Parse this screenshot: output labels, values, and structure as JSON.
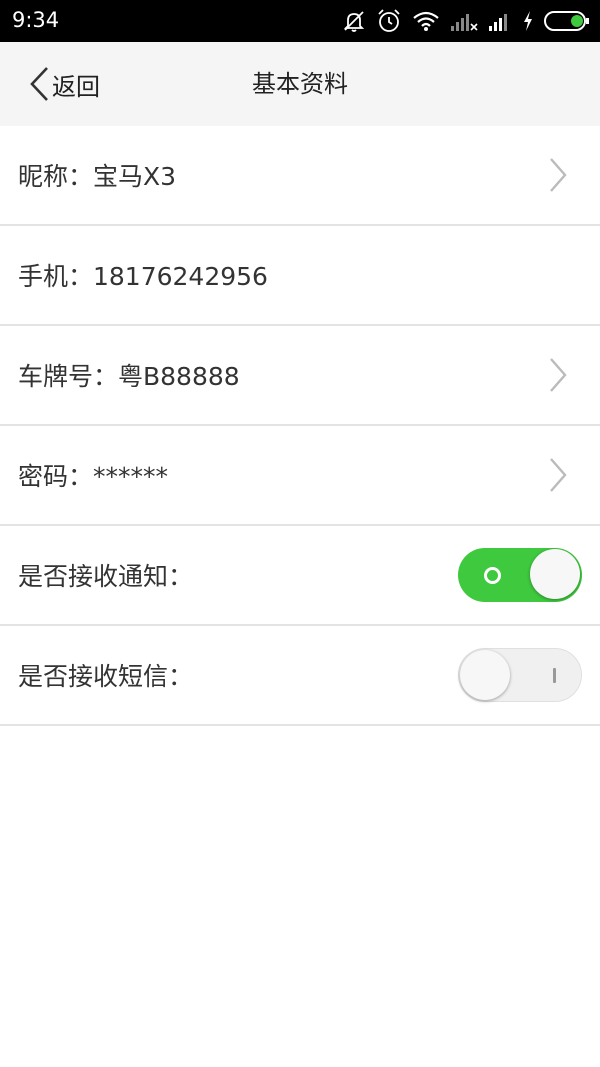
{
  "status_bar": {
    "time": "9:34",
    "icons": [
      "bell-off-icon",
      "alarm-icon",
      "wifi-icon",
      "signal-x-icon",
      "signal-icon",
      "charging-icon",
      "battery-icon"
    ]
  },
  "navbar": {
    "back_label": "返回",
    "title": "基本资料"
  },
  "rows": [
    {
      "label": "昵称：宝马X3",
      "has_chevron": true
    },
    {
      "label": "手机：18176242956",
      "has_chevron": false
    },
    {
      "label": "车牌号：粤B88888",
      "has_chevron": true
    },
    {
      "label": "密码：******",
      "has_chevron": true
    },
    {
      "label": "是否接收通知：",
      "toggle": "on"
    },
    {
      "label": "是否接收短信：",
      "toggle": "off"
    }
  ],
  "colors": {
    "toggle_on": "#3ec93e",
    "navbar_bg": "#f5f5f5",
    "status_bar_bg": "#000000"
  }
}
